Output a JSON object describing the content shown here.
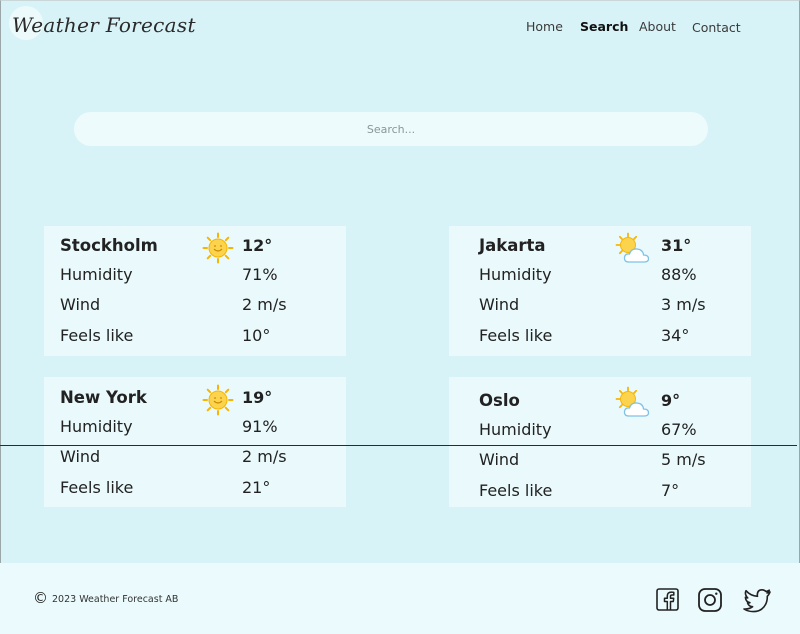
{
  "header": {
    "logo": "Weather Forecast",
    "nav": [
      {
        "label": "Home"
      },
      {
        "label": "Search"
      },
      {
        "label": "About"
      },
      {
        "label": "Contact"
      }
    ]
  },
  "search": {
    "placeholder": "Search..."
  },
  "cities": [
    {
      "city": "Stockholm",
      "icon": "sun-icon",
      "temp": "12°",
      "humidity_label": "Humidity",
      "humidity": "71%",
      "wind_label": "Wind",
      "wind": "2 m/s",
      "feels_label": "Feels like",
      "feels": "10°"
    },
    {
      "city": "Jakarta",
      "icon": "partly-cloudy-icon",
      "temp": "31°",
      "humidity_label": "Humidity",
      "humidity": "88%",
      "wind_label": "Wind",
      "wind": "3 m/s",
      "feels_label": "Feels like",
      "feels": "34°"
    },
    {
      "city": "New York",
      "icon": "sun-icon",
      "temp": "19°",
      "humidity_label": "Humidity",
      "humidity": "91%",
      "wind_label": "Wind",
      "wind": "2 m/s",
      "feels_label": "Feels like",
      "feels": "21°"
    },
    {
      "city": "Oslo",
      "icon": "partly-cloudy-icon",
      "temp": "9°",
      "humidity_label": "Humidity",
      "humidity": "67%",
      "wind_label": "Wind",
      "wind": "5 m/s",
      "feels_label": "Feels like",
      "feels": "7°"
    }
  ],
  "footer": {
    "copyright_symbol": "©",
    "copyright_text": "2023 Weather Forecast AB",
    "social": [
      "facebook-icon",
      "instagram-icon",
      "twitter-icon"
    ]
  },
  "colors": {
    "background": "#d8f3f7",
    "card": "#eafafc",
    "footer": "#ebfbfd",
    "sun": "#f7c531",
    "cloud": "#9fd3ee"
  }
}
